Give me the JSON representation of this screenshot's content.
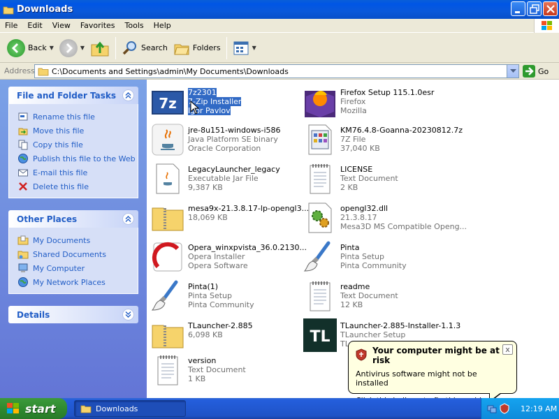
{
  "window": {
    "title": "Downloads"
  },
  "menu": [
    "File",
    "Edit",
    "View",
    "Favorites",
    "Tools",
    "Help"
  ],
  "toolbar": {
    "back": "Back",
    "search": "Search",
    "folders": "Folders"
  },
  "address": {
    "label": "Address",
    "path": "C:\\Documents and Settings\\admin\\My Documents\\Downloads",
    "go": "Go"
  },
  "left_pane": {
    "tasks": {
      "title": "File and Folder Tasks",
      "items": [
        "Rename this file",
        "Move this file",
        "Copy this file",
        "Publish this file to the Web",
        "E-mail this file",
        "Delete this file"
      ]
    },
    "places": {
      "title": "Other Places",
      "items": [
        "My Documents",
        "Shared Documents",
        "My Computer",
        "My Network Places"
      ]
    },
    "details": {
      "title": "Details"
    }
  },
  "files": [
    {
      "name": "7z2301",
      "line2": "7-Zip Installer",
      "line3": "Igor Pavlov",
      "icon": "7zip-icon",
      "selected": true
    },
    {
      "name": "Firefox Setup 115.1.0esr",
      "line2": "Firefox",
      "line3": "Mozilla",
      "icon": "firefox-icon"
    },
    {
      "name": "jre-8u151-windows-i586",
      "line2": "Java Platform SE binary",
      "line3": "Oracle Corporation",
      "icon": "java-icon"
    },
    {
      "name": "KM76.4.8-Goanna-20230812.7z",
      "line2": "7Z File",
      "line3": "37,040 KB",
      "icon": "7z-file-icon"
    },
    {
      "name": "LegacyLauncher_legacy",
      "line2": "Executable Jar File",
      "line3": "9,387 KB",
      "icon": "jar-file-icon"
    },
    {
      "name": "LICENSE",
      "line2": "Text Document",
      "line3": "2 KB",
      "icon": "text-document-icon"
    },
    {
      "name": "mesa9x-21.3.8.17-lp-opengl3...",
      "line2": "18,069 KB",
      "line3": "",
      "icon": "zip-folder-icon"
    },
    {
      "name": "opengl32.dll",
      "line2": "21.3.8.17",
      "line3": "Mesa3D MS Compatible Openg...",
      "icon": "dll-gear-icon"
    },
    {
      "name": "Opera_winxpvista_36.0.2130...",
      "line2": "Opera Installer",
      "line3": "Opera Software",
      "icon": "opera-icon"
    },
    {
      "name": "Pinta",
      "line2": "Pinta Setup",
      "line3": "Pinta Community",
      "icon": "pinta-brush-icon"
    },
    {
      "name": "Pinta(1)",
      "line2": "Pinta Setup",
      "line3": "Pinta Community",
      "icon": "pinta-brush-icon"
    },
    {
      "name": "readme",
      "line2": "Text Document",
      "line3": "12 KB",
      "icon": "text-document-icon"
    },
    {
      "name": "TLauncher-2.885",
      "line2": "6,098 KB",
      "line3": "",
      "icon": "zip-folder-icon"
    },
    {
      "name": "TLauncher-2.885-Installer-1.1.3",
      "line2": "TLauncher Setup",
      "line3": "TL",
      "icon": "tlauncher-icon"
    },
    {
      "name": "version",
      "line2": "Text Document",
      "line3": "1 KB",
      "icon": "text-document-icon"
    }
  ],
  "balloon": {
    "title": "Your computer might be at risk",
    "line1": "Antivirus software might not be installed",
    "line2": "Click this balloon to fix this problem.",
    "close": "x"
  },
  "taskbar": {
    "start": "start",
    "task": "Downloads",
    "clock": "12:19 AM"
  }
}
